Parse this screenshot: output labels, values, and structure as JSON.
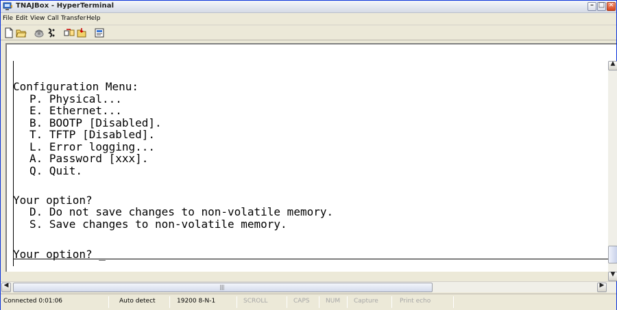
{
  "window": {
    "title": "TNAJBox - HyperTerminal"
  },
  "menubar": {
    "items": [
      "File",
      "Edit",
      "View",
      "Call",
      "Transfer",
      "Help"
    ]
  },
  "toolbar": {
    "icons": [
      "new-connection-icon",
      "open-icon",
      "call-icon",
      "disconnect-icon",
      "send-icon",
      "receive-icon",
      "properties-icon"
    ]
  },
  "terminal": {
    "lines": [
      "Configuration Menu:",
      "P. Physical...",
      "E. Ethernet...",
      "B. BOOTP [Disabled].",
      "T. TFTP [Disabled].",
      "L. Error logging...",
      "A. Password [xxx].",
      "Q. Quit.",
      "Your option?",
      "D. Do not save changes to non-volatile memory.",
      "S. Save changes to non-volatile memory.",
      "Your option? _"
    ]
  },
  "statusbar": {
    "connected": "Connected 0:01:06",
    "detect": "Auto detect",
    "settings": "19200 8-N-1",
    "scroll": "SCROLL",
    "caps": "CAPS",
    "num": "NUM",
    "capture": "Capture",
    "print_echo": "Print echo"
  }
}
